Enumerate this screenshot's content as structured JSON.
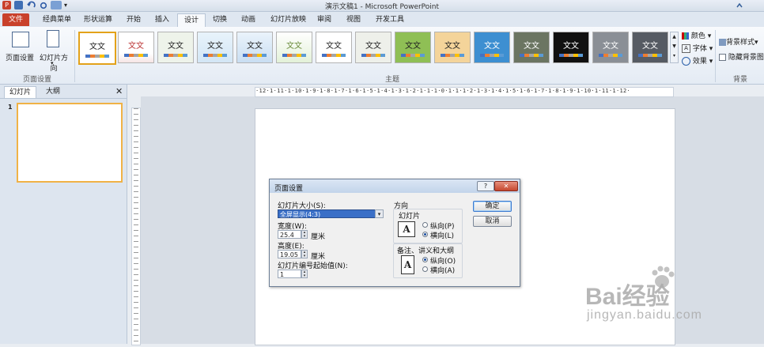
{
  "window": {
    "title": "演示文稿1 - Microsoft PowerPoint"
  },
  "tabs": [
    {
      "label": "文件"
    },
    {
      "label": "经典菜单"
    },
    {
      "label": "形状运算"
    },
    {
      "label": "开始"
    },
    {
      "label": "插入"
    },
    {
      "label": "设计"
    },
    {
      "label": "切换"
    },
    {
      "label": "动画"
    },
    {
      "label": "幻灯片放映"
    },
    {
      "label": "审阅"
    },
    {
      "label": "视图"
    },
    {
      "label": "开发工具"
    }
  ],
  "ribbon": {
    "page_setup_label": "页面设置",
    "slide_orientation_label": "幻灯片方向",
    "group_page_setup": "页面设置",
    "group_themes": "主题",
    "group_background": "背景",
    "theme_text": "文文",
    "colors_label": "颜色",
    "fonts_label": "字体",
    "effects_label": "效果",
    "bg_styles_label": "背景样式",
    "hide_bg_label": "隐藏背景图"
  },
  "pane": {
    "tab_slides": "幻灯片",
    "tab_outline": "大纲",
    "slide_number": "1"
  },
  "ruler": {
    "text": "·12·1·11·1·10·1·9·1·8·1·7·1·6·1·5·1·4·1·3·1·2·1·1·1·0·1·1·1·2·1·3·1·4·1·5·1·6·1·7·1·8·1·9·1·10·1·11·1·12·"
  },
  "dialog": {
    "title": "页面设置",
    "slide_size_label": "幻灯片大小(S):",
    "slide_size_value": "全屏显示(4:3)",
    "width_label": "宽度(W):",
    "width_value": "25.4",
    "height_label": "高度(E):",
    "height_value": "19.05",
    "unit": "厘米",
    "start_number_label": "幻灯片编号起始值(N):",
    "start_number_value": "1",
    "orientation_title": "方向",
    "slides_group": "幻灯片",
    "notes_group": "备注、讲义和大纲",
    "portrait": "纵向(P)",
    "landscape": "横向(L)",
    "portrait_notes": "纵向(O)",
    "landscape_notes": "横向(A)",
    "ok": "确定",
    "cancel": "取消",
    "help": "?"
  },
  "watermark": {
    "brand": "Bai经验",
    "url": "jingyan.baidu.com"
  }
}
